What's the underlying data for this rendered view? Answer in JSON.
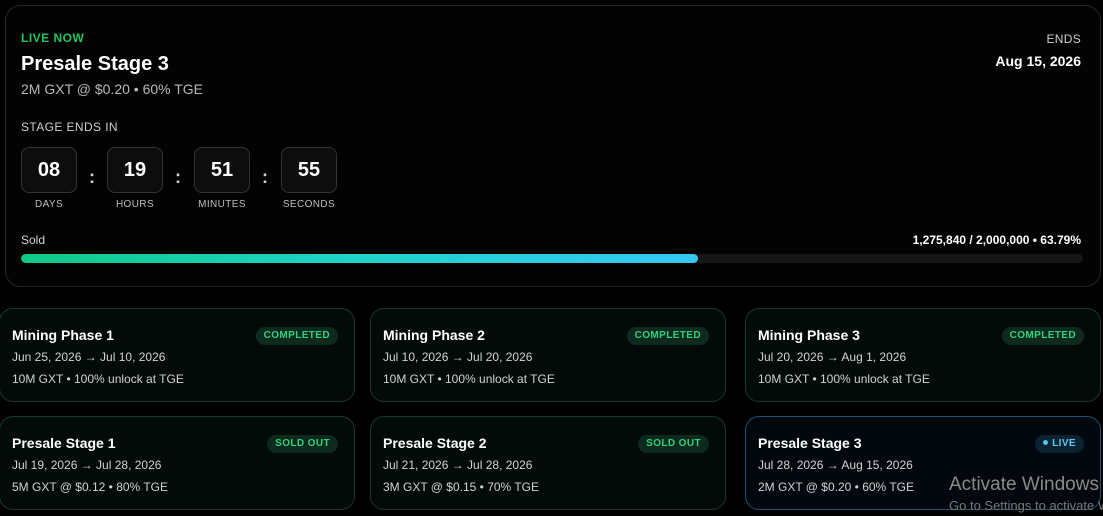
{
  "hero": {
    "status": "LIVE NOW",
    "title": "Presale Stage 3",
    "subtitle": "2M GXT @ $0.20 • 60% TGE",
    "ends_label": "ENDS",
    "ends_date": "Aug 15, 2026",
    "countdown_label": "STAGE ENDS IN",
    "countdown": [
      {
        "value": "08",
        "unit": "DAYS"
      },
      {
        "value": "19",
        "unit": "HOURS"
      },
      {
        "value": "51",
        "unit": "MINUTES"
      },
      {
        "value": "55",
        "unit": "SECONDS"
      }
    ],
    "separator": ":",
    "sold_label": "Sold",
    "sold_stats": "1,275,840 / 2,000,000 • 63.79%",
    "progress_fraction": 0.6379
  },
  "stages": [
    {
      "title": "Mining Phase 1",
      "badge": "COMPLETED",
      "dates": "Jun 25, 2026 → Jul 10, 2026",
      "detail": "10M GXT • 100% unlock at TGE"
    },
    {
      "title": "Mining Phase 2",
      "badge": "COMPLETED",
      "dates": "Jul 10, 2026 → Jul 20, 2026",
      "detail": "10M GXT • 100% unlock at TGE"
    },
    {
      "title": "Mining Phase 3",
      "badge": "COMPLETED",
      "dates": "Jul 20, 2026 → Aug 1, 2026",
      "detail": "10M GXT • 100% unlock at TGE"
    },
    {
      "title": "Presale Stage 1",
      "badge": "SOLD OUT",
      "dates": "Jul 19, 2026 → Jul 28, 2026",
      "detail": "5M GXT @ $0.12 • 80% TGE"
    },
    {
      "title": "Presale Stage 2",
      "badge": "SOLD OUT",
      "dates": "Jul 21, 2026 → Jul 28, 2026",
      "detail": "3M GXT @ $0.15 • 70% TGE"
    },
    {
      "title": "Presale Stage 3",
      "badge": "LIVE",
      "dates": "Jul 28, 2026 → Aug 15, 2026",
      "detail": "2M GXT @ $0.20 • 60% TGE"
    }
  ],
  "watermark": {
    "title": "Activate Windows",
    "subtitle": "Go to Settings to activate Windows."
  },
  "colors": {
    "live_green": "#22c55e",
    "progress_start": "#10c987",
    "progress_end": "#36c8f5",
    "live_blue": "#5cc9f5"
  }
}
